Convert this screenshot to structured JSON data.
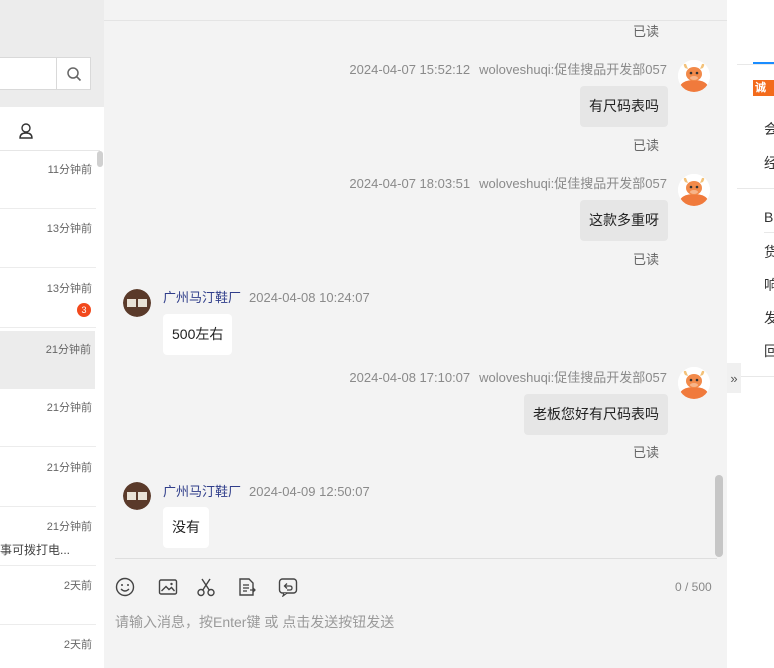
{
  "sidebar": {
    "conversations": [
      {
        "time": "11分钟前",
        "snippet": "",
        "badge": ""
      },
      {
        "time": "13分钟前",
        "snippet": "",
        "badge": ""
      },
      {
        "time": "13分钟前",
        "snippet": "",
        "badge": "3"
      },
      {
        "time": "21分钟前",
        "snippet": "",
        "badge": ""
      },
      {
        "time": "21分钟前",
        "snippet": "",
        "badge": ""
      },
      {
        "time": "21分钟前",
        "snippet": "",
        "badge": ""
      },
      {
        "time": "21分钟前",
        "snippet": "事可拨打电...",
        "badge": ""
      },
      {
        "time": "2天前",
        "snippet": "",
        "badge": ""
      },
      {
        "time": "2天前",
        "snippet": "",
        "badge": ""
      }
    ],
    "icons": {
      "search": "search-icon",
      "contact": "contact-icon"
    }
  },
  "chat": {
    "top_read": "已读",
    "messages": [
      {
        "direction": "out",
        "time": "2024-04-07 15:52:12",
        "sender": "woloveshuqi:促佳搜品开发部057",
        "text": "有尺码表吗",
        "status": "已读"
      },
      {
        "direction": "out",
        "time": "2024-04-07 18:03:51",
        "sender": "woloveshuqi:促佳搜品开发部057",
        "text": "这款多重呀",
        "status": "已读"
      },
      {
        "direction": "in",
        "time": "2024-04-08 10:24:07",
        "sender": "广州马汀鞋厂",
        "text": "500左右",
        "status": ""
      },
      {
        "direction": "out",
        "time": "2024-04-08 17:10:07",
        "sender": "woloveshuqi:促佳搜品开发部057",
        "text": "老板您好有尺码表吗",
        "status": "已读"
      },
      {
        "direction": "in",
        "time": "2024-04-09 12:50:07",
        "sender": "广州马汀鞋厂",
        "text": "没有",
        "status": ""
      }
    ],
    "toolbar": {
      "icons": [
        "emoji-icon",
        "image-icon",
        "scissors-icon",
        "document-icon",
        "return-icon"
      ]
    },
    "counter": "0 / 500",
    "input_placeholder": "请输入消息，按Enter键 或 点击发送按钮发送"
  },
  "right_panel": {
    "brand_label": "诚信",
    "items_top": [
      "会",
      "经"
    ],
    "items_bottom": [
      "B",
      "货",
      "响",
      "发",
      "回"
    ],
    "collapse_icon": "double-chevron-right-icon"
  },
  "colors": {
    "accent": "#1a8cff",
    "badge": "#f2491c",
    "sender_in": "#2f3d8a",
    "brand": "#f36b1c"
  }
}
